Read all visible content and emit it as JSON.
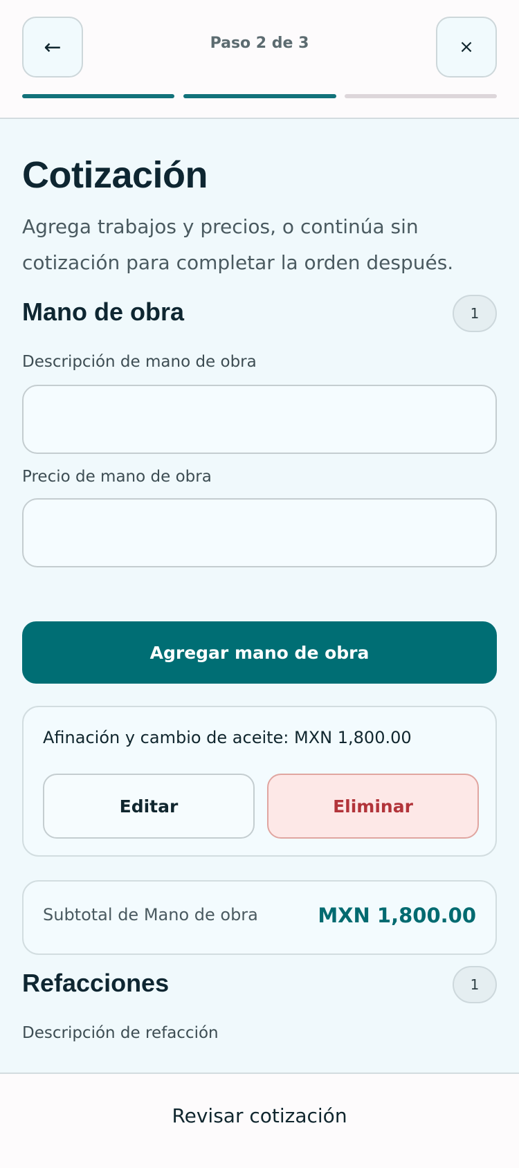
{
  "header": {
    "back_icon": "←",
    "close_icon": "×",
    "step_label": "Paso 2 de 3",
    "progress": [
      {
        "state": "done",
        "color": "#12727a"
      },
      {
        "state": "done",
        "color": "#12727a"
      },
      {
        "state": "pending",
        "color": "#ddd6da"
      }
    ]
  },
  "page": {
    "title": "Cotización",
    "subtitle": "Agrega trabajos y precios, o continúa sin cotización para completar la orden después."
  },
  "labor": {
    "title": "Mano de obra",
    "count": "1",
    "description_label": "Descripción de mano de obra",
    "description_value": "",
    "price_label": "Precio de mano de obra",
    "price_value": "",
    "add_button": "Agregar mano de obra",
    "items": [
      {
        "text": "Afinación y cambio de aceite: MXN 1,800.00",
        "edit_label": "Editar",
        "delete_label": "Eliminar"
      }
    ],
    "subtotal_label": "Subtotal de Mano de obra",
    "subtotal_value": "MXN 1,800.00"
  },
  "parts": {
    "title": "Refacciones",
    "count": "1",
    "description_label": "Descripción de refacción"
  },
  "footer": {
    "review_button": "Revisar cotización"
  },
  "colors": {
    "accent": "#006e74",
    "danger": "#b2343a",
    "danger_bg": "#fde8e7",
    "background": "#f0f9fc"
  }
}
